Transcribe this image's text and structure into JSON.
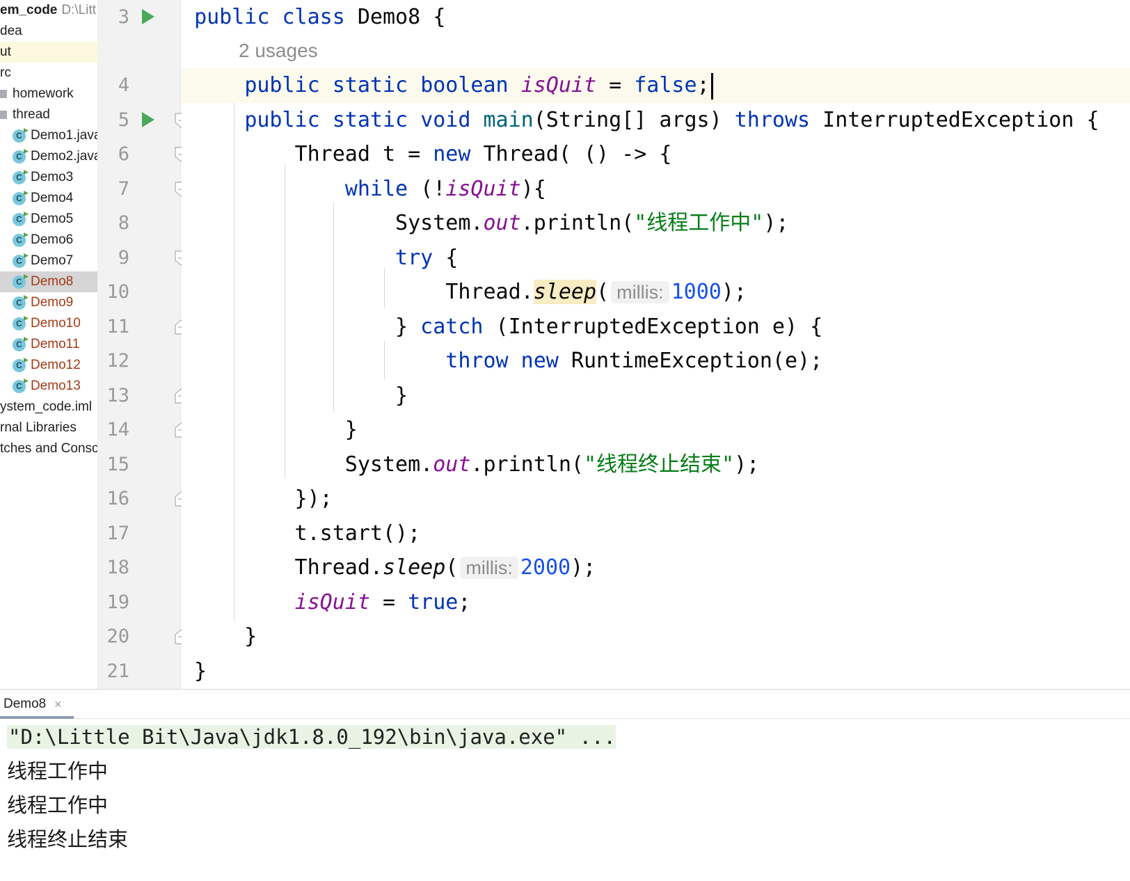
{
  "project_tree": {
    "root_label": "em_code",
    "root_path": "D:\\Litt",
    "items": [
      {
        "label": "dea",
        "kind": "folder"
      },
      {
        "label": "ut",
        "kind": "folder",
        "highlighted": true
      },
      {
        "label": "rc",
        "kind": "folder"
      },
      {
        "label": "homework",
        "kind": "package"
      },
      {
        "label": "thread",
        "kind": "package"
      },
      {
        "label": "Demo1.java",
        "kind": "class"
      },
      {
        "label": "Demo2.java",
        "kind": "class"
      },
      {
        "label": "Demo3",
        "kind": "class"
      },
      {
        "label": "Demo4",
        "kind": "class"
      },
      {
        "label": "Demo5",
        "kind": "class"
      },
      {
        "label": "Demo6",
        "kind": "class"
      },
      {
        "label": "Demo7",
        "kind": "class"
      },
      {
        "label": "Demo8",
        "kind": "class",
        "selected": true,
        "modified": true
      },
      {
        "label": "Demo9",
        "kind": "class",
        "modified": true
      },
      {
        "label": "Demo10",
        "kind": "class",
        "modified": true
      },
      {
        "label": "Demo11",
        "kind": "class",
        "modified": true
      },
      {
        "label": "Demo12",
        "kind": "class",
        "modified": true
      },
      {
        "label": "Demo13",
        "kind": "class",
        "modified": true
      },
      {
        "label": "ystem_code.iml",
        "kind": "file"
      },
      {
        "label": "rnal Libraries",
        "kind": "folder"
      },
      {
        "label": "tches and Conso",
        "kind": "folder"
      }
    ]
  },
  "editor": {
    "usages_hint": "2 usages",
    "param_hint": "millis:",
    "line_numbers": [
      "3",
      "4",
      "5",
      "6",
      "7",
      "8",
      "9",
      "10",
      "11",
      "12",
      "13",
      "14",
      "15",
      "16",
      "17",
      "18",
      "19",
      "20",
      "21"
    ],
    "tokens": {
      "public": "public",
      "class": "class",
      "static": "static",
      "boolean": "boolean",
      "void": "void",
      "throws": "throws",
      "new": "new",
      "while": "while",
      "try": "try",
      "catch": "catch",
      "throw": "throw",
      "false": "false",
      "true": "true",
      "class_name": "Demo8",
      "field": "isQuit",
      "main": "main",
      "out": "out",
      "sleep": "sleep",
      "string_working": "\"线程工作中\"",
      "string_end": "\"线程终止结束\"",
      "num_1000": "1000",
      "num_2000": "2000"
    },
    "colors": {
      "keyword": "#0033b3",
      "field": "#871094",
      "string": "#067d17",
      "number": "#1750eb",
      "current_line": "#fcfaed",
      "run_icon": "#4aa85a"
    }
  },
  "run_panel": {
    "tab_label": "Demo8",
    "close_icon": "×",
    "lines": [
      "\"D:\\Little Bit\\Java\\jdk1.8.0_192\\bin\\java.exe\" ...",
      "线程工作中",
      "线程工作中",
      "线程终止结束"
    ]
  }
}
